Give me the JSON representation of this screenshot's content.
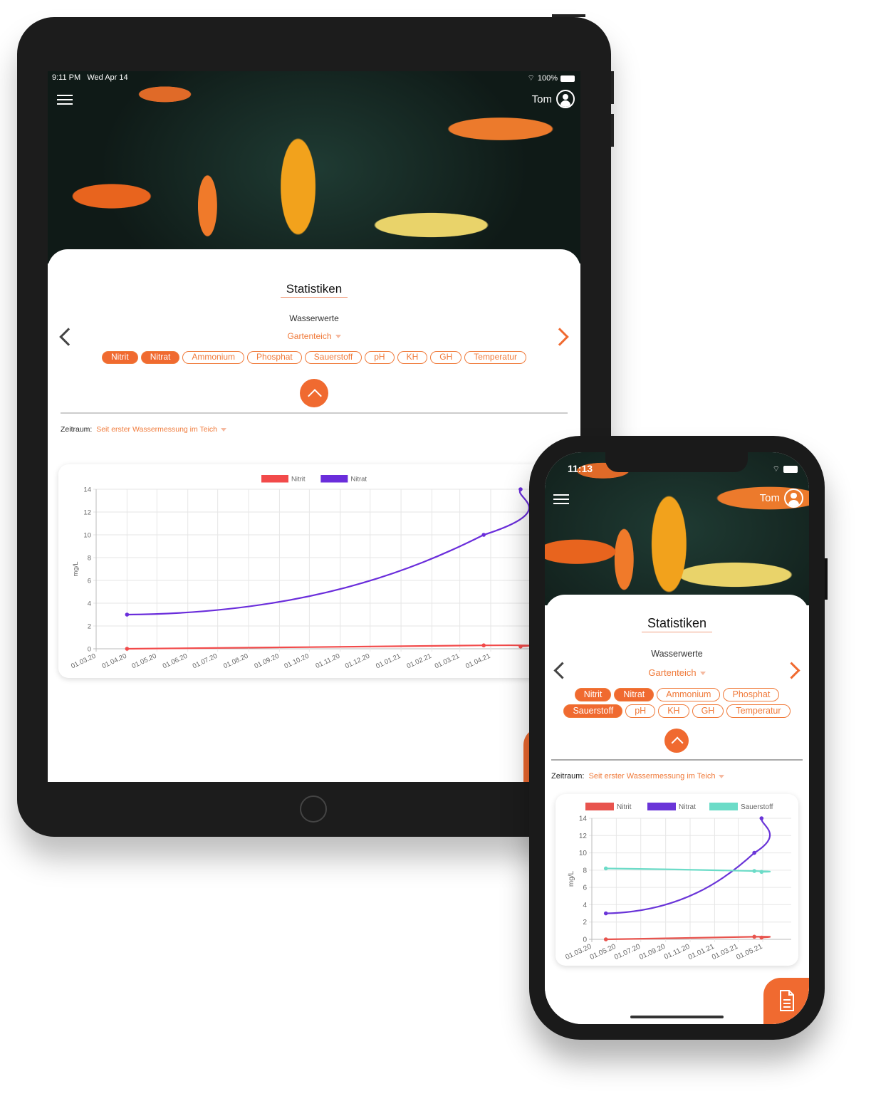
{
  "colors": {
    "accent": "#f06a30",
    "nitrit": "#f24a4a",
    "nitrat": "#6a2ddb",
    "sauerstoff": "#6cdcc8"
  },
  "tablet": {
    "status": {
      "time": "9:11 PM",
      "date": "Wed Apr 14",
      "battery": "100%"
    },
    "user": "Tom",
    "title": "Statistiken",
    "subtitle": "Wasserwerte",
    "pond": "Gartenteich",
    "chips": [
      {
        "label": "Nitrit",
        "active": true
      },
      {
        "label": "Nitrat",
        "active": true
      },
      {
        "label": "Ammonium",
        "active": false
      },
      {
        "label": "Phosphat",
        "active": false
      },
      {
        "label": "Sauerstoff",
        "active": false
      },
      {
        "label": "pH",
        "active": false
      },
      {
        "label": "KH",
        "active": false
      },
      {
        "label": "GH",
        "active": false
      },
      {
        "label": "Temperatur",
        "active": false
      }
    ],
    "zeitraum_label": "Zeitraum:",
    "zeitraum_value": "Seit erster Wassermessung im Teich"
  },
  "phone": {
    "status": {
      "time": "11:13"
    },
    "user": "Tom",
    "title": "Statistiken",
    "subtitle": "Wasserwerte",
    "pond": "Gartenteich",
    "chips": [
      {
        "label": "Nitrit",
        "active": true
      },
      {
        "label": "Nitrat",
        "active": true
      },
      {
        "label": "Ammonium",
        "active": false
      },
      {
        "label": "Phosphat",
        "active": false
      },
      {
        "label": "Sauerstoff",
        "active": true
      },
      {
        "label": "pH",
        "active": false
      },
      {
        "label": "KH",
        "active": false
      },
      {
        "label": "GH",
        "active": false
      },
      {
        "label": "Temperatur",
        "active": false
      }
    ],
    "zeitraum_label": "Zeitraum:",
    "zeitraum_value": "Seit erster Wassermessung im Teich"
  },
  "chart_data": [
    {
      "type": "line",
      "ylabel": "mg/L",
      "ylim": [
        0,
        14
      ],
      "yticks": [
        0,
        2,
        4,
        6,
        8,
        10,
        12,
        14
      ],
      "grid": true,
      "legend": "top",
      "xticks": [
        "01.03.20",
        "01.04.20",
        "01.05.20",
        "01.06.20",
        "01.07.20",
        "01.08.20",
        "01.09.20",
        "01.10.20",
        "01.11.20",
        "01.12.20",
        "01.01.21",
        "01.02.21",
        "01.03.21",
        "01.04.21"
      ],
      "series": [
        {
          "name": "Nitrit",
          "color": "#f24a4a",
          "x": [
            "2020-04-01",
            "2021-03-25",
            "2021-05-01"
          ],
          "values": [
            0,
            0.3,
            0.2
          ]
        },
        {
          "name": "Nitrat",
          "color": "#6a2ddb",
          "x": [
            "2020-04-01",
            "2021-03-25",
            "2021-05-01"
          ],
          "values": [
            3,
            10,
            14
          ]
        }
      ]
    },
    {
      "type": "line",
      "ylabel": "mg/L",
      "ylim": [
        0,
        14
      ],
      "yticks": [
        0,
        2,
        4,
        6,
        8,
        10,
        12,
        14
      ],
      "grid": true,
      "legend": "top",
      "xticks": [
        "01.03.20",
        "01.05.20",
        "01.07.20",
        "01.09.20",
        "01.11.20",
        "01.01.21",
        "01.03.21",
        "01.05.21"
      ],
      "series": [
        {
          "name": "Nitrit",
          "color": "#e8544e",
          "x": [
            "2020-04-05",
            "2021-04-10",
            "2021-04-28"
          ],
          "values": [
            0,
            0.3,
            0.2
          ]
        },
        {
          "name": "Nitrat",
          "color": "#6a35d8",
          "x": [
            "2020-04-05",
            "2021-04-10",
            "2021-04-28"
          ],
          "values": [
            3,
            10,
            14
          ]
        },
        {
          "name": "Sauerstoff",
          "color": "#6cdcc8",
          "x": [
            "2020-04-05",
            "2021-04-10",
            "2021-04-28"
          ],
          "values": [
            8.2,
            7.9,
            7.8
          ]
        }
      ]
    }
  ]
}
